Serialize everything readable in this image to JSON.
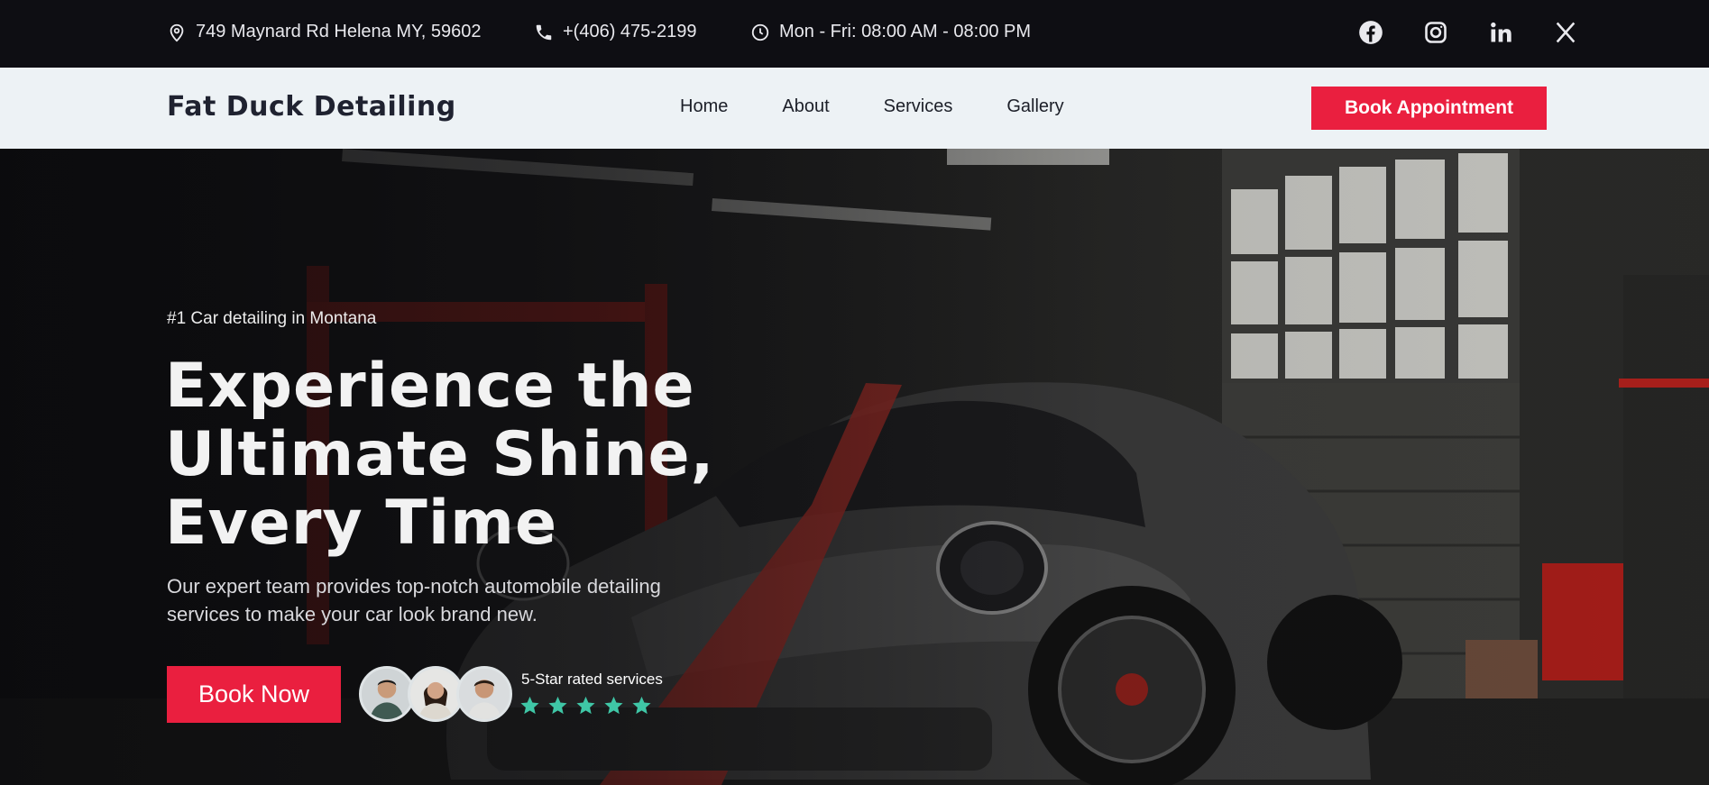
{
  "topbar": {
    "address": "749 Maynard Rd Helena MY, 59602",
    "phone": "+(406) 475-2199",
    "hours": "Mon - Fri: 08:00 AM - 08:00 PM",
    "social": [
      {
        "name": "facebook-icon"
      },
      {
        "name": "instagram-icon"
      },
      {
        "name": "linkedin-icon"
      },
      {
        "name": "x-icon"
      }
    ]
  },
  "nav": {
    "brand": "Fat Duck Detailing",
    "items": [
      "Home",
      "About",
      "Services",
      "Gallery"
    ],
    "cta": "Book Appointment"
  },
  "hero": {
    "eyebrow": "#1 Car detailing in Montana",
    "headline_1": "Experience the",
    "headline_2": "Ultimate Shine,",
    "headline_3": "Every Time",
    "subtitle": "Our expert team provides top-notch automobile detailing services to make your car look brand new.",
    "button": "Book Now",
    "rating_label": "5-Star rated services",
    "stars": 5
  },
  "colors": {
    "accent": "#ea1f3f",
    "star": "#3fc6a6",
    "nav_bg": "#edf2f5",
    "topbar_bg": "#0e0e13"
  }
}
